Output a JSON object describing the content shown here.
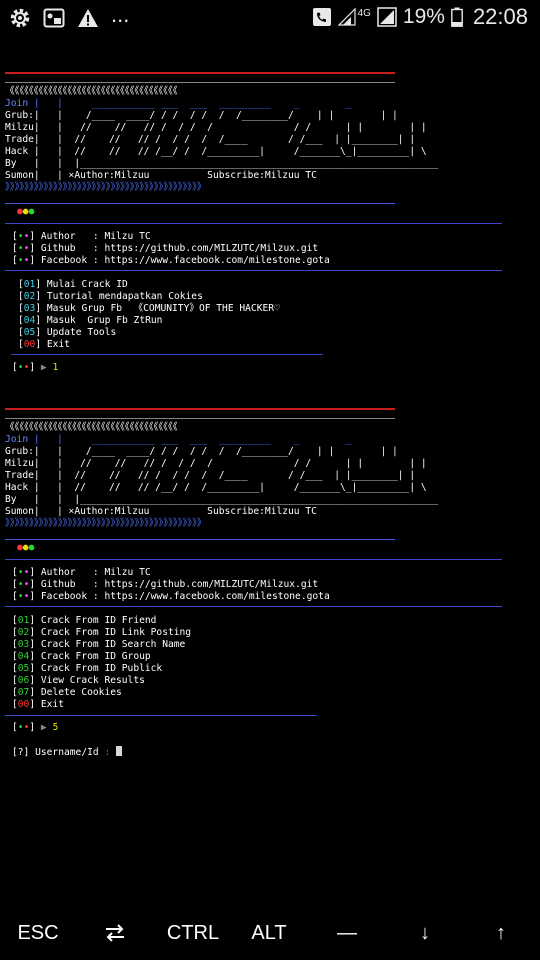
{
  "status_bar": {
    "left_icons": [
      "settings-gear-icon",
      "picture-in-picture-icon",
      "warning-icon"
    ],
    "overflow": "...",
    "network": "4G",
    "battery": "19%",
    "time": "22:08"
  },
  "terminal": {
    "session1": {
      "banner": {
        "pattern": "《《《《《《《《《《《《《《《《《《《《《《《《《《《《《《《《《《《",
        "rows": [
          {
            "prefix": "Join",
            "art": " |   |     ___________ ___  ___  _________    _        _"
          },
          {
            "prefix": "Grub:",
            "art": "|   |    /____  ____/ / /  / /  /  /________/    | |        | |"
          },
          {
            "prefix": "Milzu",
            "art": "|   |   //    //   // /  / /  /              / /      | |        | |"
          },
          {
            "prefix": "Trade",
            "art": "|   |  //    //   // /  / /  /  /____       / /___  | |________| |"
          },
          {
            "prefix": "Hack ",
            "art": "|   |  //    //   // /__/ /  /_________|     /_______\\_|_________| \\"
          },
          {
            "prefix": "By   ",
            "art": "|   |  |______________________________________________________________"
          },
          {
            "prefix": "Sumon",
            "art": "|   | ×Author:Milzuu          Subscribe:Milzuu TC"
          }
        ],
        "arrows": "》》》》》》》》》》》》》》》》》》》》》》》》》》》》》》》》》》》》》》》》》"
      },
      "info": [
        {
          "label": "Author   : ",
          "value": "Milzu TC"
        },
        {
          "label": "Github   : ",
          "value": "https://github.com/MILZUTC/Milzux.git"
        },
        {
          "label": "Facebook : ",
          "value": "https://www.facebook.com/milestone.gota"
        }
      ],
      "menu": [
        {
          "num": "01",
          "label": "Mulai Crack ID"
        },
        {
          "num": "02",
          "label": "Tutorial mendapatkan Cokies"
        },
        {
          "num": "03",
          "label": "Masuk Grup Fb  《COMUNITY》OF THE HACKER♡"
        },
        {
          "num": "04",
          "label": "Masuk  Grup Fb ZtRun"
        },
        {
          "num": "05",
          "label": "Update Tools"
        },
        {
          "num": "00",
          "label": "Exit"
        }
      ],
      "prompt_value": "1"
    },
    "session2": {
      "menu": [
        {
          "num": "01",
          "label": "Crack From ID Friend"
        },
        {
          "num": "02",
          "label": "Crack From ID Link Posting"
        },
        {
          "num": "03",
          "label": "Crack From ID Search Name"
        },
        {
          "num": "04",
          "label": "Crack From ID Group"
        },
        {
          "num": "05",
          "label": "Crack From ID Publick"
        },
        {
          "num": "06",
          "label": "View Crack Results"
        },
        {
          "num": "07",
          "label": "Delete Cookies"
        },
        {
          "num": "00",
          "label": "Exit"
        }
      ],
      "prompt_value": "5",
      "input_prompt": {
        "tag": "[?]",
        "label": "Username/Id",
        "sep": ":"
      }
    }
  },
  "extra_keys": [
    {
      "name": "esc-key",
      "label": "ESC"
    },
    {
      "name": "tab-key",
      "label": "⇄",
      "icon": "tab-arrows-icon"
    },
    {
      "name": "ctrl-key",
      "label": "CTRL"
    },
    {
      "name": "alt-key",
      "label": "ALT"
    },
    {
      "name": "dash-key",
      "label": "—"
    },
    {
      "name": "down-key",
      "label": "↓"
    },
    {
      "name": "up-key",
      "label": "↑"
    }
  ]
}
